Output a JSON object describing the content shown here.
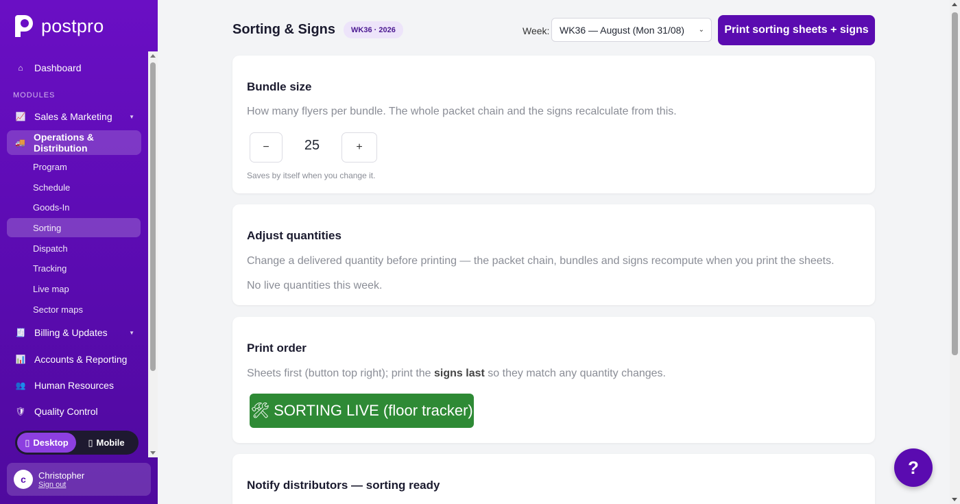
{
  "brand": {
    "name": "postpro"
  },
  "sidebar": {
    "dashboard": {
      "label": "Dashboard",
      "icon": "home-icon"
    },
    "modules_label": "MODULES",
    "items": [
      {
        "label": "Sales & Marketing",
        "icon": "chart-icon"
      },
      {
        "label": "Operations & Distribution",
        "icon": "truck-icon"
      },
      {
        "label": "Billing & Updates",
        "icon": "receipt-icon"
      },
      {
        "label": "Accounts & Reporting",
        "icon": "ledger-icon"
      },
      {
        "label": "Human Resources",
        "icon": "people-icon"
      },
      {
        "label": "Quality Control",
        "icon": "shield-icon"
      }
    ],
    "sub_items": [
      "Program",
      "Schedule",
      "Goods-In",
      "Sorting",
      "Dispatch",
      "Tracking",
      "Live map",
      "Sector maps"
    ],
    "mode_toggle": {
      "desktop": "Desktop",
      "mobile": "Mobile"
    },
    "user": {
      "initial": "c",
      "name": "Christopher",
      "sign_out": "Sign out"
    }
  },
  "header": {
    "title": "Sorting & Signs",
    "week_badge": "WK36 · 2026",
    "week_label": "Week:",
    "week_selected": "WK36 — August (Mon 31/08)",
    "print_button": "Print sorting sheets + signs"
  },
  "cards": {
    "bundle": {
      "title": "Bundle size",
      "desc": "How many flyers per bundle. The whole packet chain and the signs recalculate from this.",
      "minus": "−",
      "value": "25",
      "plus": "+",
      "note": "Saves by itself when you change it."
    },
    "adjust": {
      "title": "Adjust quantities",
      "desc": "Change a delivered quantity before printing — the packet chain, bundles and signs recompute when you print the sheets.",
      "empty": "No live quantities this week."
    },
    "print_order": {
      "title": "Print order",
      "desc_before": "Sheets first (button top right); print the ",
      "desc_bold": "signs last",
      "desc_after": " so they match any quantity changes.",
      "live_icon": "🛠",
      "live_button": "SORTING LIVE (floor tracker)"
    },
    "notify": {
      "title": "Notify distributors — sorting ready"
    }
  },
  "help": {
    "label": "?"
  },
  "colors": {
    "brand": "#5a0bb0",
    "live": "#2e8a35",
    "badge_bg": "#ede4fa"
  }
}
